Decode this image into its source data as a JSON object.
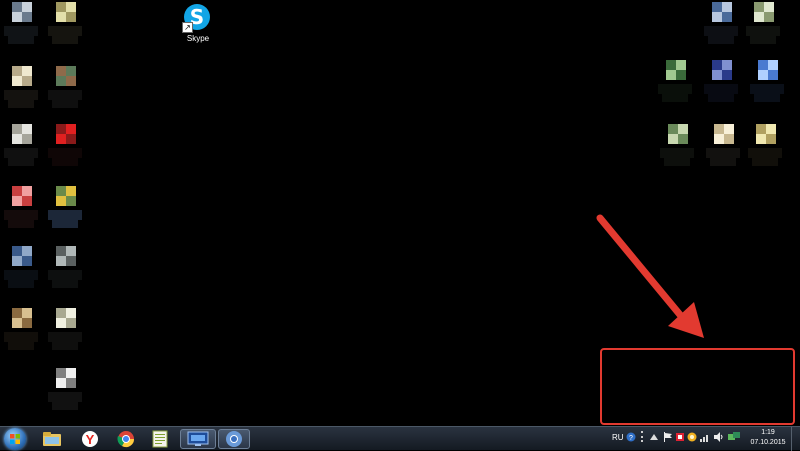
{
  "desktop": {
    "shortcut": {
      "label": "Skype",
      "icon": "skype-icon"
    },
    "pixelated_icons_left": [
      {
        "colors": [
          "#6a7a8c",
          "#c9d2db",
          "#2f3640"
        ]
      },
      {
        "colors": [
          "#a09860",
          "#e3dfa9",
          "#3c3a2c"
        ]
      },
      {
        "colors": [
          "#b7aa8a",
          "#efe8cf",
          "#3a352a"
        ]
      },
      {
        "colors": [
          "#8f6a4a",
          "#5c7a5a",
          "#2c2c2c"
        ]
      },
      {
        "colors": [
          "#a5a49a",
          "#e5e5e0",
          "#2e2e2e"
        ]
      },
      {
        "colors": [
          "#8a1a1a",
          "#e02020",
          "#2a1010"
        ]
      },
      {
        "colors": [
          "#c84040",
          "#f0a0a0",
          "#3a2020"
        ]
      },
      {
        "colors": [
          "#6a8a4a",
          "#e0c040",
          "#5070a0"
        ]
      },
      {
        "colors": [
          "#3a5a8a",
          "#90a8c8",
          "#1e2836"
        ]
      },
      {
        "colors": [
          "#5a6060",
          "#b0b8b8",
          "#262a2a"
        ]
      },
      {
        "colors": [
          "#8a6a40",
          "#d8c090",
          "#30281c"
        ]
      },
      {
        "colors": [
          "#a8a890",
          "#f0f0e0",
          "#2c2c28"
        ]
      },
      {
        "colors": [
          "#808080",
          "#f0f0f0",
          "#303030"
        ]
      }
    ],
    "pixelated_icons_right": [
      {
        "colors": [
          "#4a6a9a",
          "#b8c8e0",
          "#252c38"
        ]
      },
      {
        "colors": [
          "#8a9a70",
          "#e0e8d0",
          "#2c3028"
        ]
      },
      {
        "colors": [
          "#3a6a3a",
          "#a0c890",
          "#1c2a1c"
        ]
      },
      {
        "colors": [
          "#2a3a8a",
          "#8090d0",
          "#181c34"
        ]
      },
      {
        "colors": [
          "#4a7ad0",
          "#b0d0ff",
          "#1c2a44"
        ]
      },
      {
        "colors": [
          "#6a8a5a",
          "#c8d8b0",
          "#262c22"
        ]
      },
      {
        "colors": [
          "#c8b890",
          "#f8f0d8",
          "#34302a"
        ]
      },
      {
        "colors": [
          "#b0a060",
          "#f0e8b0",
          "#302c1c"
        ]
      }
    ]
  },
  "annotation": {
    "color": "#e23a30"
  },
  "taskbar": {
    "start_icon": "windows-start-icon",
    "pinned": [
      {
        "name": "explorer-icon",
        "active": false
      },
      {
        "name": "yandex-browser-icon",
        "active": false
      },
      {
        "name": "chrome-icon",
        "active": false
      },
      {
        "name": "notepad-icon",
        "active": false
      },
      {
        "name": "remote-desktop-icon",
        "active": true
      },
      {
        "name": "chromium-icon",
        "active": true
      }
    ],
    "tray": {
      "language": "RU",
      "time": "1:19",
      "date": "07.10.2015"
    }
  }
}
